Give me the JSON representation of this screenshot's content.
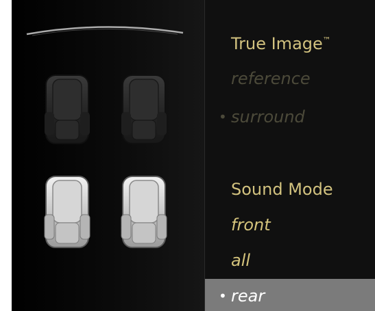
{
  "true_image": {
    "heading": "True Image",
    "trademark": "™",
    "options": [
      "reference",
      "surround"
    ],
    "selected": "surround"
  },
  "sound_mode": {
    "heading": "Sound Mode",
    "options": [
      "front",
      "all",
      "rear"
    ],
    "selected": "rear"
  },
  "bullet": "•",
  "colors": {
    "accent_gold": "#d2c27f",
    "dim_gold": "#4c4a3a",
    "highlight": "#7b7b7b"
  },
  "seats": {
    "front_row_active": false,
    "rear_row_active": true
  }
}
